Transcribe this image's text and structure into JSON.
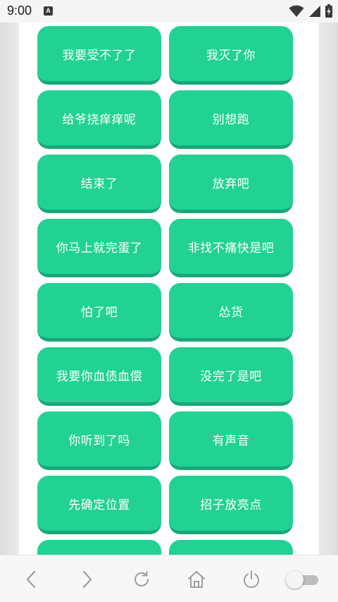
{
  "status_bar": {
    "time": "9:00",
    "notification_badge": "A",
    "icons": [
      "wifi-icon",
      "signal-icon",
      "battery-icon"
    ]
  },
  "sound_buttons": [
    "我要受不了了",
    "我灭了你",
    "给爷挠痒痒呢",
    "别想跑",
    "结束了",
    "放弃吧",
    "你马上就完蛋了",
    "非找不痛快是吧",
    "怕了吧",
    "怂货",
    "我要你血债血偿",
    "没完了是吧",
    "你听到了吗",
    "有声音",
    "先确定位置",
    "招子放亮点",
    "",
    ""
  ],
  "nav_bar": {
    "icons": [
      "back-icon",
      "forward-icon",
      "refresh-icon",
      "home-icon",
      "power-icon"
    ],
    "toggle_on": false
  },
  "colors": {
    "button": "#22d293",
    "button_shadow": "#1ba679",
    "nav_icon": "#9e9e9e"
  }
}
